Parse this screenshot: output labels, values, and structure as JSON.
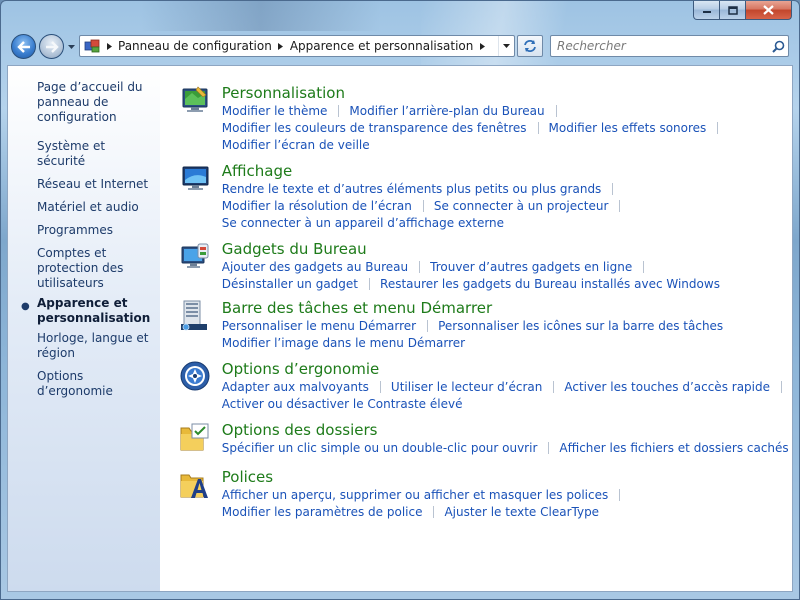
{
  "window": {
    "colors": {
      "title_green": "#1e7b1a",
      "link_blue": "#1a52b8"
    }
  },
  "address": {
    "crumbs": [
      "Panneau de configuration",
      "Apparence et personnalisation"
    ]
  },
  "search": {
    "placeholder": "Rechercher"
  },
  "sidebar": {
    "items": [
      {
        "label": "Page d’accueil du panneau de configuration",
        "active": false
      },
      {
        "label": "Système et sécurité",
        "active": false
      },
      {
        "label": "Réseau et Internet",
        "active": false
      },
      {
        "label": "Matériel et audio",
        "active": false
      },
      {
        "label": "Programmes",
        "active": false
      },
      {
        "label": "Comptes et protection des utilisateurs",
        "active": false
      },
      {
        "label": "Apparence et personnalisation",
        "active": true
      },
      {
        "label": "Horloge, langue et région",
        "active": false
      },
      {
        "label": "Options d’ergonomie",
        "active": false
      }
    ]
  },
  "categories": [
    {
      "title": "Personnalisation",
      "icon": "personalization-icon",
      "rows": [
        [
          "Modifier le thème",
          "Modifier l’arrière-plan du Bureau"
        ],
        [
          "Modifier les couleurs de transparence des fenêtres",
          "Modifier les effets sonores"
        ],
        [
          "Modifier l’écran de veille"
        ]
      ]
    },
    {
      "title": "Affichage",
      "icon": "display-icon",
      "rows": [
        [
          "Rendre le texte et d’autres éléments plus petits ou plus grands"
        ],
        [
          "Modifier la résolution de l’écran",
          "Se connecter à un projecteur"
        ],
        [
          "Se connecter à un appareil d’affichage externe"
        ]
      ]
    },
    {
      "title": "Gadgets du Bureau",
      "icon": "desktop-gadgets-icon",
      "rows": [
        [
          "Ajouter des gadgets au Bureau",
          "Trouver d’autres gadgets en ligne"
        ],
        [
          "Désinstaller un gadget",
          "Restaurer les gadgets du Bureau installés avec Windows"
        ]
      ]
    },
    {
      "title": "Barre des tâches et menu Démarrer",
      "icon": "taskbar-start-icon",
      "rows": [
        [
          "Personnaliser le menu Démarrer",
          "Personnaliser les icônes sur la barre des tâches"
        ],
        [
          "Modifier l’image dans le menu Démarrer"
        ]
      ]
    },
    {
      "title": "Options d’ergonomie",
      "icon": "ease-of-access-icon",
      "rows": [
        [
          "Adapter aux malvoyants",
          "Utiliser le lecteur d’écran",
          "Activer les touches d’accès rapide"
        ],
        [
          "Activer ou désactiver le Contraste élevé"
        ]
      ]
    },
    {
      "title": "Options des dossiers",
      "icon": "folder-options-icon",
      "rows": [
        [
          "Spécifier un clic simple ou un double-clic pour ouvrir",
          "Afficher les fichiers et dossiers cachés"
        ]
      ]
    },
    {
      "title": "Polices",
      "icon": "fonts-icon",
      "rows": [
        [
          "Afficher un aperçu, supprimer ou afficher et masquer les polices"
        ],
        [
          "Modifier les paramètres de police",
          "Ajuster le texte ClearType"
        ]
      ]
    }
  ]
}
